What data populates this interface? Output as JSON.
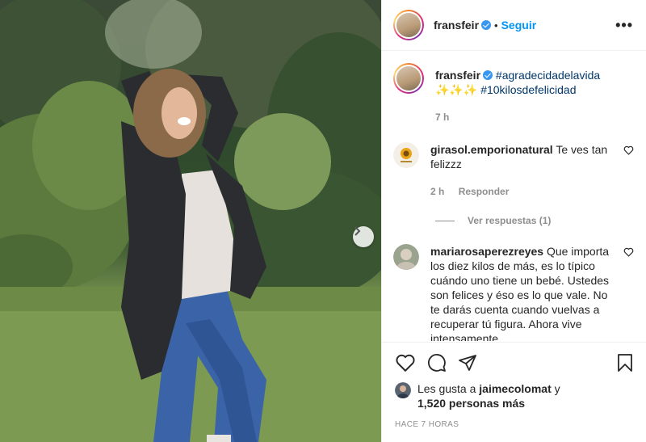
{
  "post": {
    "username": "fransfeir",
    "follow_label": "Seguir",
    "separator": "•",
    "more_icon": "•••"
  },
  "caption": {
    "username": "fransfeir",
    "text_line1": "#agradecidadelavida",
    "text_line2": "#10kilosdefelicidad",
    "time": "7 h"
  },
  "comments": [
    {
      "username": "girasol.emporionatural",
      "text": "Te ves tan felizzz",
      "time": "2 h",
      "reply_label": "Responder",
      "view_replies": "Ver respuestas (1)"
    },
    {
      "username": "mariarosaperezreyes",
      "text": "Que importa los diez kilos de más, es lo típico cuándo uno tiene un bebé. Ustedes son felices y éso es lo que vale. No te darás cuenta cuando vuelvas a recuperar tú figura. Ahora vive intensamente"
    }
  ],
  "likes": {
    "prefix": "Les gusta a",
    "user": "jaimecolomat",
    "conj": "y",
    "count": "1,520 personas más"
  },
  "timestamp": "HACE 7 HORAS",
  "colors": {
    "link": "#00376b",
    "follow": "#0095f6",
    "muted": "#8e8e8e",
    "verified": "#3897f0"
  },
  "icons": [
    "verified-icon",
    "heart-icon",
    "comment-icon",
    "share-icon",
    "bookmark-icon",
    "chevron-right-icon",
    "more-icon"
  ]
}
